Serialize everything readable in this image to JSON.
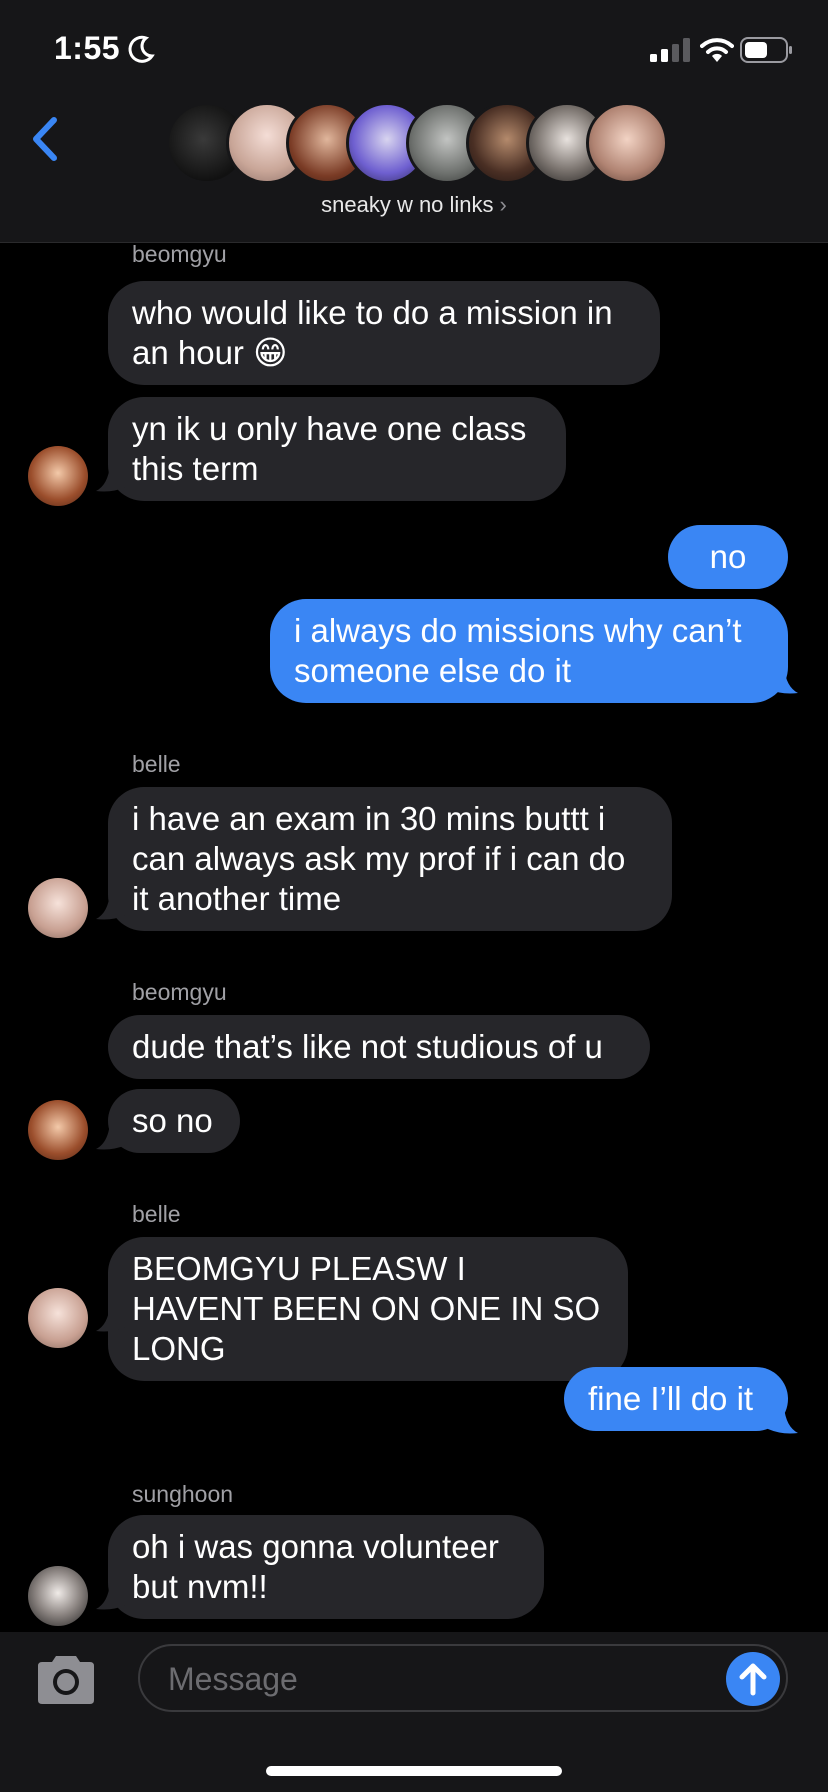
{
  "status_bar": {
    "time": "1:55",
    "moon_icon": "moon-icon",
    "signal_icon": "cellular-signal-icon",
    "wifi_icon": "wifi-icon",
    "battery_icon": "battery-icon"
  },
  "header": {
    "back_icon": "chevron-left-icon",
    "group_name": "sneaky w no links",
    "group_chevron": "›",
    "accent_color": "#3a86f4"
  },
  "messages": [
    {
      "sender": "beomgyu",
      "text": "who would like to do a mission in an hour 😁",
      "direction": "incoming"
    },
    {
      "text": "yn ik u only have one class this term",
      "direction": "incoming"
    },
    {
      "text": "no",
      "direction": "outgoing"
    },
    {
      "text": "i always do missions why can’t someone else do it",
      "direction": "outgoing"
    },
    {
      "sender": "belle",
      "text": "i have an exam in 30 mins buttt i can always ask my prof if i can do it another time",
      "direction": "incoming"
    },
    {
      "sender": "beomgyu",
      "text": "dude that’s like not studious of u",
      "direction": "incoming"
    },
    {
      "text": "so no",
      "direction": "incoming"
    },
    {
      "sender": "belle",
      "text": "BEOMGYU PLEASW I HAVENT BEEN ON ONE IN SO LONG",
      "direction": "incoming"
    },
    {
      "text": "fine I’ll do it",
      "direction": "outgoing"
    },
    {
      "sender": "sunghoon",
      "text": "oh i was gonna volunteer but nvm!!",
      "direction": "incoming"
    }
  ],
  "input": {
    "placeholder": "Message",
    "camera_icon": "camera-icon",
    "send_icon": "arrow-up-icon"
  }
}
